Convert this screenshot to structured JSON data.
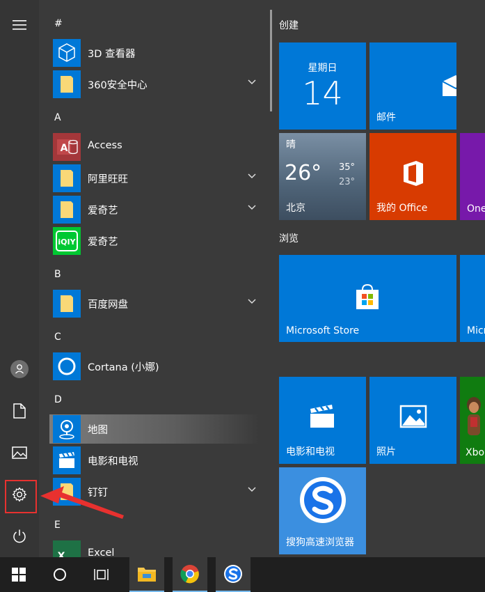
{
  "app_list": {
    "groups": [
      {
        "letter": "#",
        "apps": [
          {
            "label": "3D 查看器",
            "icon": "3d-viewer-icon",
            "has_chevron": false
          },
          {
            "label": "360安全中心",
            "icon": "folder-icon",
            "has_chevron": true
          }
        ]
      },
      {
        "letter": "A",
        "apps": [
          {
            "label": "Access",
            "icon": "access-icon",
            "has_chevron": false
          },
          {
            "label": "阿里旺旺",
            "icon": "folder-icon",
            "has_chevron": true
          },
          {
            "label": "爱奇艺",
            "icon": "folder-icon",
            "has_chevron": true
          },
          {
            "label": "爱奇艺",
            "icon": "iqiyi-icon",
            "has_chevron": false
          }
        ]
      },
      {
        "letter": "B",
        "apps": [
          {
            "label": "百度网盘",
            "icon": "folder-icon",
            "has_chevron": true
          }
        ]
      },
      {
        "letter": "C",
        "apps": [
          {
            "label": "Cortana (小娜)",
            "icon": "cortana-icon",
            "has_chevron": false
          }
        ]
      },
      {
        "letter": "D",
        "apps": [
          {
            "label": "地图",
            "icon": "maps-icon",
            "has_chevron": false,
            "selected": true
          },
          {
            "label": "电影和电视",
            "icon": "movies-icon",
            "has_chevron": false
          },
          {
            "label": "钉钉",
            "icon": "folder-icon",
            "has_chevron": true
          }
        ]
      },
      {
        "letter": "E",
        "apps": [
          {
            "label": "Excel",
            "icon": "excel-icon",
            "has_chevron": false
          }
        ]
      }
    ]
  },
  "tiles": {
    "group1_title": "创建",
    "group2_title": "浏览",
    "calendar": {
      "weekday": "星期日",
      "day": "14"
    },
    "mail": {
      "label": "邮件"
    },
    "weather": {
      "condition": "晴",
      "temp": "26°",
      "high": "35°",
      "low": "23°",
      "city": "北京"
    },
    "office": {
      "label": "我的 Office"
    },
    "onenote": {
      "label": "One"
    },
    "store": {
      "label": "Microsoft Store"
    },
    "micro": {
      "label": "Micr"
    },
    "movies": {
      "label": "电影和电视"
    },
    "photos": {
      "label": "照片"
    },
    "xbox": {
      "label": "Xbo"
    },
    "sogou": {
      "label": "搜狗高速浏览器"
    }
  },
  "colors": {
    "tile_blue": "#0078d7",
    "office_orange": "#d83b01",
    "onenote_purple": "#7719aa",
    "highlight_red": "#e8312f"
  }
}
